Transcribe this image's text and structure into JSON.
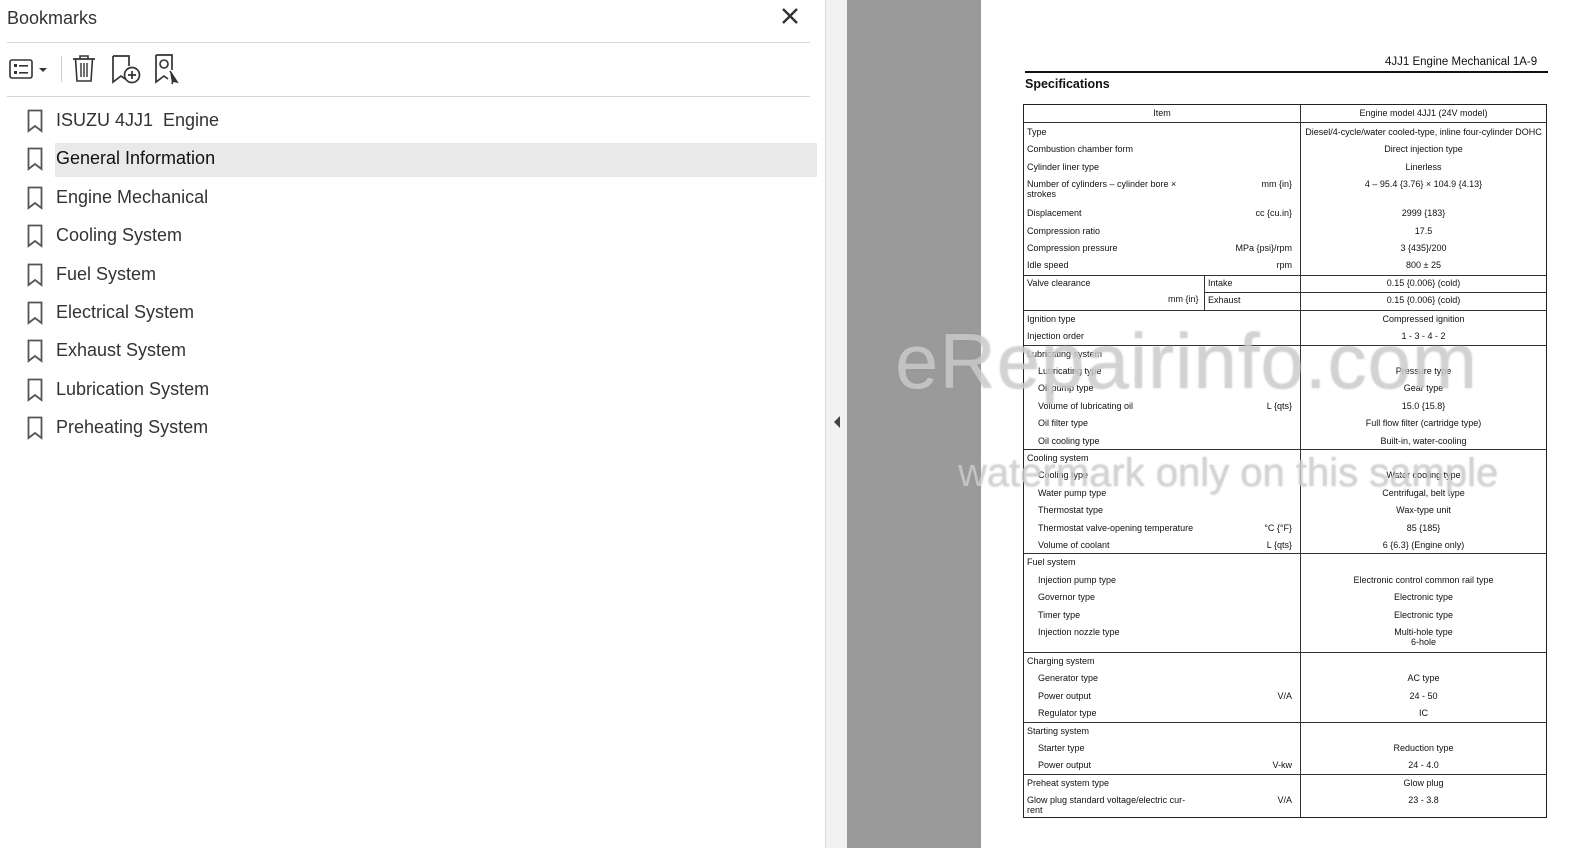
{
  "panel": {
    "title": "Bookmarks",
    "close_icon": "close-icon",
    "toolbar": [
      {
        "name": "options-menu-button",
        "icon": "list-options-icon"
      },
      {
        "name": "delete-bookmark-button",
        "icon": "trash-icon"
      },
      {
        "name": "add-bookmark-button",
        "icon": "add-bookmark-icon"
      },
      {
        "name": "find-bookmark-button",
        "icon": "bookmark-search-icon"
      }
    ],
    "bookmarks": [
      {
        "label": "ISUZU 4JJ1  Engine",
        "selected": false
      },
      {
        "label": "General Information",
        "selected": true
      },
      {
        "label": "Engine Mechanical",
        "selected": false
      },
      {
        "label": "Cooling System",
        "selected": false
      },
      {
        "label": "Fuel System",
        "selected": false
      },
      {
        "label": "Electrical System",
        "selected": false
      },
      {
        "label": "Exhaust System",
        "selected": false
      },
      {
        "label": "Lubrication System",
        "selected": false
      },
      {
        "label": "Preheating System",
        "selected": false
      }
    ]
  },
  "document": {
    "header": "4JJ1 Engine Mechanical 1A-9",
    "section_title": "Specifications",
    "table": {
      "col_item": "Item",
      "col_model": "Engine model 4JJ1 (24V model)",
      "rows": [
        {
          "label": "Type",
          "unit": "",
          "value": "Diesel/4-cycle/water cooled-type, inline four-cylinder DOHC",
          "indent": 0
        },
        {
          "label": "Combustion chamber form",
          "unit": "",
          "value": "Direct injection type",
          "indent": 0
        },
        {
          "label": "Cylinder liner type",
          "unit": "",
          "value": "Linerless",
          "indent": 0
        },
        {
          "label": "Number  of  cylinders  –  cylinder  bore  ×",
          "label2": "strokes",
          "unit": "mm {in}",
          "value": "4 – 95.4 {3.76} × 104.9 {4.13}",
          "indent": 0
        },
        {
          "label": "Displacement",
          "unit": "cc {cu.in}",
          "value": "2999 {183}",
          "indent": 0
        },
        {
          "label": "Compression ratio",
          "unit": "",
          "value": "17.5",
          "indent": 0
        },
        {
          "label": "Compression pressure",
          "unit": "MPa {psi}/rpm",
          "value": "3 {435}/200",
          "indent": 0
        },
        {
          "label": "Idle speed",
          "unit": "rpm",
          "value": "800 ± 25",
          "indent": 0
        }
      ],
      "valve": {
        "label": "Valve clearance",
        "unit": "mm {in}",
        "intake_label": "Intake",
        "intake_value": "0.15 {0.006} (cold)",
        "exhaust_label": "Exhaust",
        "exhaust_value": "0.15 {0.006} (cold)"
      },
      "rows2": [
        {
          "label": "Ignition type",
          "unit": "",
          "value": "Compressed ignition",
          "indent": 0
        },
        {
          "label": "Injection order",
          "unit": "",
          "value": "1 - 3 - 4 - 2",
          "indent": 0
        },
        {
          "label": "Lubricating system",
          "unit": "",
          "value": "",
          "indent": 0
        },
        {
          "label": "Lubricating type",
          "unit": "",
          "value": "Pressure type",
          "indent": 1
        },
        {
          "label": "Oil pump type",
          "unit": "",
          "value": "Gear type",
          "indent": 1
        },
        {
          "label": "Volume of lubricating oil",
          "unit": "L {qts}",
          "value": "15.0 {15.8}",
          "indent": 1
        },
        {
          "label": "Oil filter type",
          "unit": "",
          "value": "Full flow filter (cartridge type)",
          "indent": 1
        },
        {
          "label": "Oil cooling type",
          "unit": "",
          "value": "Built-in, water-cooling",
          "indent": 1
        },
        {
          "label": "Cooling system",
          "unit": "",
          "value": "",
          "indent": 0
        },
        {
          "label": "Cooling type",
          "unit": "",
          "value": "Water cooling type",
          "indent": 1
        },
        {
          "label": "Water pump type",
          "unit": "",
          "value": "Centrifugal, belt type",
          "indent": 1
        },
        {
          "label": "Thermostat type",
          "unit": "",
          "value": "Wax-type unit",
          "indent": 1
        },
        {
          "label": "Thermostat valve-opening temperature",
          "unit": "°C {°F}",
          "value": "85 {185}",
          "indent": 1
        },
        {
          "label": "Volume of coolant",
          "unit": "L {qts}",
          "value": "6 {6.3} (Engine only)",
          "indent": 1
        },
        {
          "label": "Fuel system",
          "unit": "",
          "value": "",
          "indent": 0
        },
        {
          "label": "Injection pump type",
          "unit": "",
          "value": "Electronic control common rail type",
          "indent": 1
        },
        {
          "label": "Governor type",
          "unit": "",
          "value": "Electronic type",
          "indent": 1
        },
        {
          "label": "Timer type",
          "unit": "",
          "value": "Electronic type",
          "indent": 1
        },
        {
          "label": "Injection nozzle type",
          "unit": "",
          "value": "Multi-hole type",
          "value2": "6-hole",
          "indent": 1
        },
        {
          "label": "Charging system",
          "unit": "",
          "value": "",
          "indent": 0
        },
        {
          "label": "Generator type",
          "unit": "",
          "value": "AC type",
          "indent": 1
        },
        {
          "label": "Power output",
          "unit": "V/A",
          "value": "24 - 50",
          "indent": 1
        },
        {
          "label": "Regulator type",
          "unit": "",
          "value": "IC",
          "indent": 1
        },
        {
          "label": "Starting system",
          "unit": "",
          "value": "",
          "indent": 0
        },
        {
          "label": "Starter type",
          "unit": "",
          "value": "Reduction type",
          "indent": 1
        },
        {
          "label": "Power output",
          "unit": "V-kw",
          "value": "24 - 4.0",
          "indent": 1
        },
        {
          "label": "Preheat system type",
          "unit": "",
          "value": "Glow plug",
          "indent": 0
        },
        {
          "label": "Glow  plug  standard  voltage/electric  cur-",
          "label2": "rent",
          "unit": "V/A",
          "value": "23 - 3.8",
          "indent": 0
        }
      ]
    },
    "watermark_main": "eRepairinfo.com",
    "watermark_sub": "watermark only on this sample"
  }
}
